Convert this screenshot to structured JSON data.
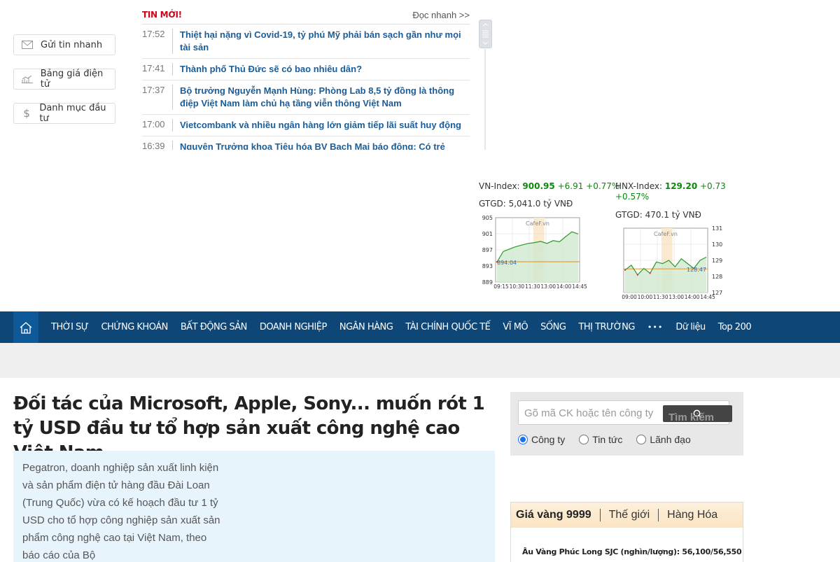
{
  "quick_buttons": [
    {
      "label": "Gửi tin nhanh",
      "icon": "mail-icon"
    },
    {
      "label": "Bảng giá điện tử",
      "icon": "chart-icon"
    },
    {
      "label": "Danh mục đầu tư",
      "icon": "dollar-icon"
    }
  ],
  "ticker": {
    "title": "TIN MỚI!",
    "read_fast": "Đọc nhanh >>",
    "items": [
      {
        "time": "17:52",
        "headline": "Thiệt hại nặng vì Covid-19, tỷ phú Mỹ phải bán sạch gần như mọi tài sản"
      },
      {
        "time": "17:41",
        "headline": "Thành phố Thủ Đức sẽ có bao nhiêu dân?"
      },
      {
        "time": "17:37",
        "headline": "Bộ trưởng Nguyễn Mạnh Hùng: Phòng Lab 8,5 tỷ đồng là thông điệp Việt Nam làm chủ hạ tầng viễn thông Việt Nam"
      },
      {
        "time": "17:00",
        "headline": "Vietcombank và nhiều ngân hàng lớn giảm tiếp lãi suất huy động"
      },
      {
        "time": "16:39",
        "headline": "Nguyên Trưởng khoa Tiêu hóa BV Bạch Mai báo động: Có trẻ"
      }
    ]
  },
  "indices": {
    "vn": {
      "label": "VN-Index:",
      "value": "900.95",
      "change": "+6.91 +0.77%",
      "gtgd": "GTGD: 5,041.0 tỷ VNĐ"
    },
    "hnx": {
      "label": "HNX-Index:",
      "value": "129.20",
      "change": "+0.73",
      "change2": "+0.57%",
      "gtgd": "GTGD: 470.1 tỷ VNĐ"
    }
  },
  "chart_data": [
    {
      "type": "line",
      "title": "",
      "watermark": "CafeF.vn",
      "x_ticks": [
        "09:15",
        "10:30",
        "11:30",
        "13:00",
        "14:00",
        "14:45"
      ],
      "y_ticks": [
        "905",
        "901",
        "897",
        "893",
        "889"
      ],
      "ylim": [
        889,
        905
      ],
      "reference": "894.04",
      "series": [
        {
          "values": [
            894.0,
            896.6,
            897.2,
            897.8,
            898.2,
            898.6,
            898.8,
            899.1,
            898.6,
            899.3,
            899.0,
            900.3,
            901.5,
            900.95
          ]
        }
      ]
    },
    {
      "type": "line",
      "title": "",
      "watermark": "CafeF.vn",
      "x_ticks": [
        "09:00",
        "10:00",
        "11:30",
        "13:00",
        "14:00",
        "14:45"
      ],
      "y_ticks": [
        "131",
        "130",
        "129",
        "128",
        "127"
      ],
      "ylim": [
        127,
        131
      ],
      "reference": "128.47",
      "series": [
        {
          "values": [
            128.4,
            128.7,
            128.1,
            128.5,
            128.2,
            128.9,
            128.8,
            129.0,
            128.6,
            129.1,
            128.8,
            128.5,
            129.0,
            129.2
          ]
        }
      ]
    }
  ],
  "nav": {
    "items": [
      "THỜI SỰ",
      "CHỨNG KHOÁN",
      "BẤT ĐỘNG SẢN",
      "DOANH NGHIỆP",
      "NGÂN HÀNG",
      "TÀI CHÍNH QUỐC TẾ",
      "VĨ MÔ",
      "SỐNG",
      "THỊ TRƯỜNG",
      "•••",
      "Dữ liệu",
      "Top 200"
    ],
    "colors": {
      "bar": "#0d4677",
      "home": "#0e5a98"
    }
  },
  "article": {
    "title": "Đối tác của Microsoft, Apple, Sony... muốn rót 1 tỷ USD đầu tư tổ hợp sản xuất công nghệ cao Việt Nam",
    "sapo": "Pegatron, doanh nghiệp sản xuất linh kiện và sản phẩm điện tử hàng đầu Đài Loan (Trung Quốc) vừa có kế hoạch đầu tư 1 tỷ USD cho tổ hợp công nghiệp sản xuất sản phẩm công nghệ cao tại Việt Nam, theo báo cáo của Bộ"
  },
  "search": {
    "placeholder": "Gõ mã CK hoặc tên công ty",
    "button": "Tìm kiếm",
    "options": [
      "Công ty",
      "Tin tức",
      "Lãnh đạo"
    ],
    "selected": "Công ty"
  },
  "gold": {
    "tabs": [
      "Giá vàng 9999",
      "Thế giới",
      "Hàng Hóa"
    ],
    "row": "Âu Vàng Phúc Long SJC (nghìn/lượng): 56,100/56,550"
  }
}
